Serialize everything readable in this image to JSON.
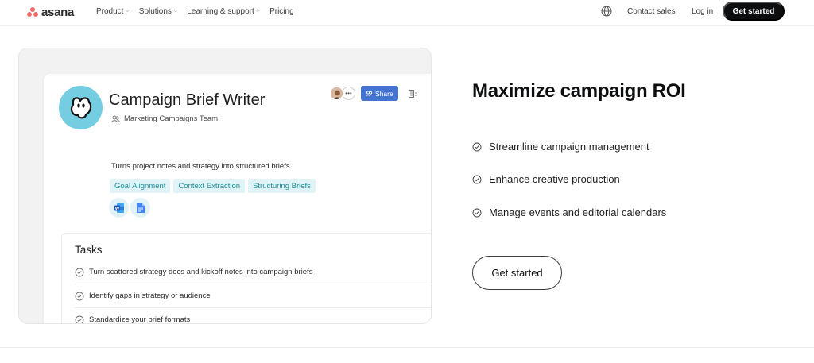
{
  "nav": {
    "logo_text": "asana",
    "links": [
      {
        "label": "Product",
        "has_dropdown": true
      },
      {
        "label": "Solutions",
        "has_dropdown": true
      },
      {
        "label": "Learning & support",
        "has_dropdown": true
      },
      {
        "label": "Pricing",
        "has_dropdown": false
      }
    ],
    "globe_icon": "globe-icon",
    "contact_label": "Contact sales",
    "login_label": "Log in",
    "cta_label": "Get started"
  },
  "agent_card": {
    "title": "Campaign Brief Writer",
    "team": "Marketing Campaigns Team",
    "share_label": "Share",
    "description": "Turns project notes and strategy into structured briefs.",
    "tags": [
      "Goal Alignment",
      "Context Extraction",
      "Structuring Briefs"
    ],
    "apps": [
      "word-icon",
      "google-docs-icon"
    ],
    "tasks_title": "Tasks",
    "tasks": [
      "Turn scattered strategy docs and kickoff notes into campaign briefs",
      "Identify gaps in strategy or audience",
      "Standardize your brief formats"
    ]
  },
  "content": {
    "headline": "Maximize campaign ROI",
    "benefits": [
      "Streamline campaign management",
      "Enhance creative production",
      "Manage events and editorial calendars"
    ],
    "cta_label": "Get started"
  },
  "colors": {
    "brand_coral": "#f06a6a",
    "share_blue": "#4573d2",
    "tag_bg": "#e0f4f7",
    "tag_text": "#1b8f99",
    "avatar_bg": "#74cde0"
  }
}
